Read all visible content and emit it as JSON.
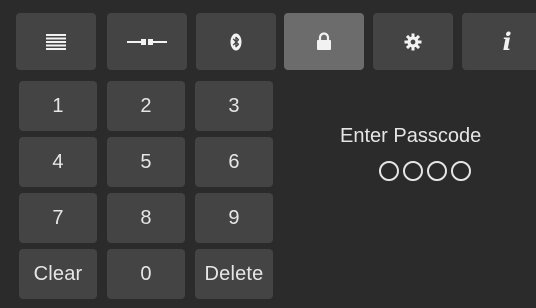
{
  "tabs": [
    {
      "name": "list",
      "icon": "list-icon",
      "active": false
    },
    {
      "name": "connection",
      "icon": "connection-icon",
      "active": false
    },
    {
      "name": "bluetooth",
      "icon": "bluetooth-icon",
      "active": false
    },
    {
      "name": "lock",
      "icon": "lock-icon",
      "active": true
    },
    {
      "name": "settings",
      "icon": "gear-icon",
      "active": false
    },
    {
      "name": "info",
      "icon": "info-icon",
      "active": false,
      "glyph": "i"
    }
  ],
  "keypad": {
    "keys": [
      "1",
      "2",
      "3",
      "4",
      "5",
      "6",
      "7",
      "8",
      "9",
      "Clear",
      "0",
      "Delete"
    ]
  },
  "passcode": {
    "title": "Enter Passcode",
    "digits_entered": 0,
    "digits_total": 4
  },
  "colors": {
    "background": "#2b2b2b",
    "button": "#444444",
    "active_tab": "#6c6c6c",
    "text": "#e6e6e6"
  }
}
